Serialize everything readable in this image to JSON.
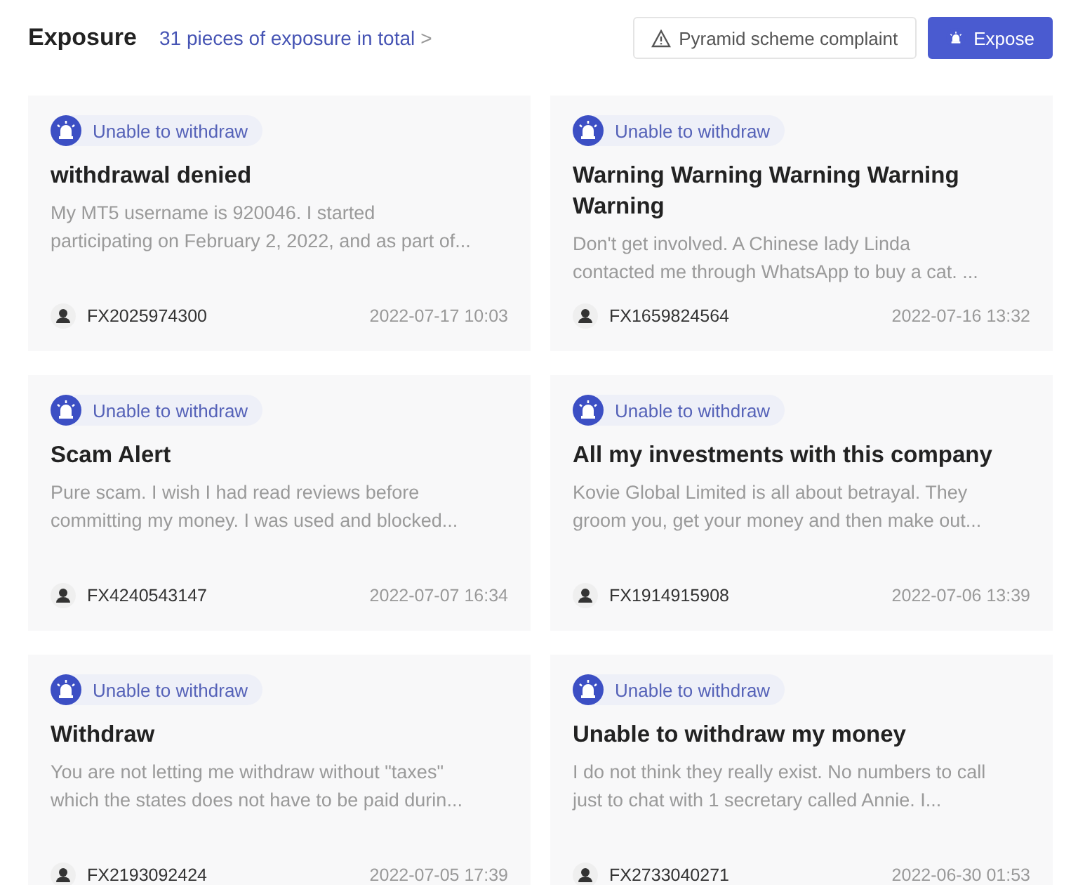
{
  "header": {
    "title": "Exposure",
    "count_link": "31 pieces of exposure in total",
    "chevron": ">",
    "buttons": [
      {
        "kind": "outline",
        "label": "Pyramid scheme complaint"
      },
      {
        "kind": "primary",
        "label": "Expose"
      }
    ]
  },
  "cards": [
    {
      "tag": "Unable to withdraw",
      "title": "withdrawal denied",
      "summary": "My MT5 username is 920046. I started\nparticipating on February 2, 2022, and as part of...",
      "user": "FX2025974300",
      "time": "2022-07-17 10:03"
    },
    {
      "tag": "Unable to withdraw",
      "title": "Warning Warning Warning Warning\nWarning",
      "summary": "Don't get involved. A Chinese lady Linda\ncontacted me through WhatsApp to buy a cat. ...",
      "user": "FX1659824564",
      "time": "2022-07-16 13:32"
    },
    {
      "tag": "Unable to withdraw",
      "title": "Scam Alert",
      "summary": "Pure scam. I wish I had read reviews before\ncommitting my money. I was used and blocked...",
      "user": "FX4240543147",
      "time": "2022-07-07 16:34"
    },
    {
      "tag": "Unable to withdraw",
      "title": "All my investments with this company",
      "summary": "Kovie Global Limited is all about betrayal. They\ngroom you, get your money and then make out...",
      "user": "FX1914915908",
      "time": "2022-07-06 13:39"
    },
    {
      "tag": "Unable to withdraw",
      "title": "Withdraw",
      "summary": "You are not letting me withdraw without \"taxes\"\nwhich the states does not have to be paid durin...",
      "user": "FX2193092424",
      "time": "2022-07-05 17:39"
    },
    {
      "tag": "Unable to withdraw",
      "title": "Unable to withdraw my money",
      "summary": "I do not think they really exist. No numbers to call\njust to chat with 1 secretary called Annie. I...",
      "user": "FX2733040271",
      "time": "2022-06-30 01:53"
    }
  ]
}
